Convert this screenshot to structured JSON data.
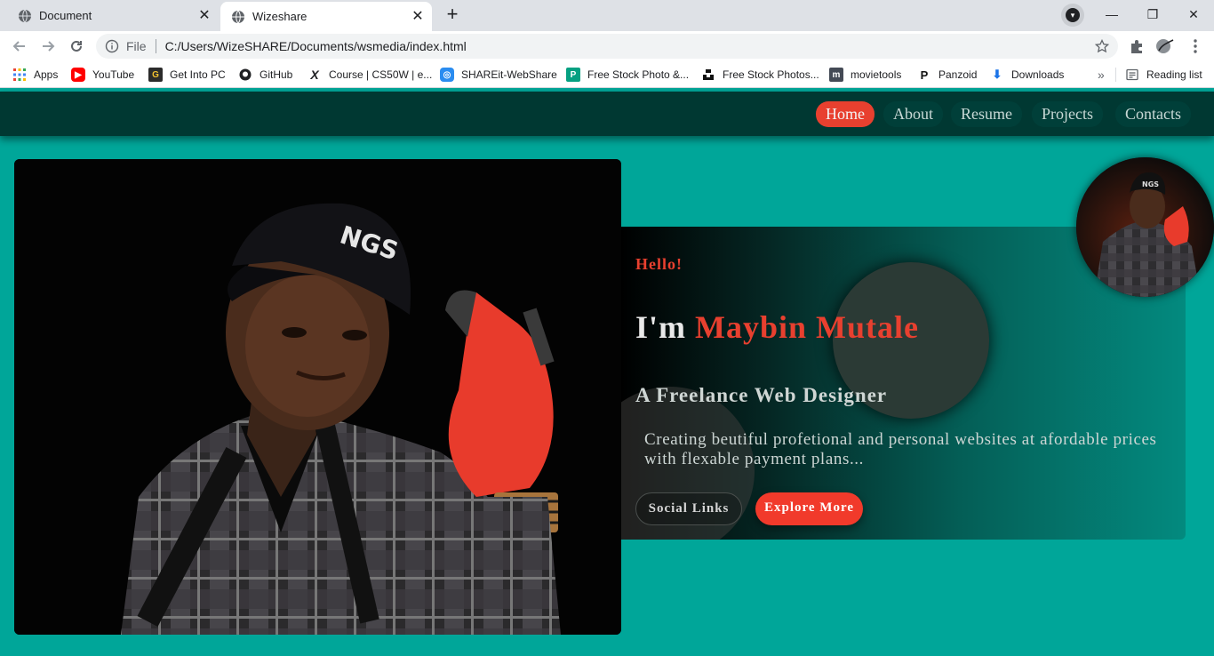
{
  "browser": {
    "tabs": [
      {
        "title": "Document",
        "active": false
      },
      {
        "title": "Wizeshare",
        "active": true
      }
    ],
    "address": {
      "scheme": "File",
      "url": "C:/Users/WizeSHARE/Documents/wsmedia/index.html"
    },
    "bookmarks": [
      {
        "label": "Apps",
        "icon": "apps-grid-icon"
      },
      {
        "label": "YouTube",
        "icon": "youtube-icon"
      },
      {
        "label": "Get Into PC",
        "icon": "getintopc-icon"
      },
      {
        "label": "GitHub",
        "icon": "github-icon"
      },
      {
        "label": "Course | CS50W | e...",
        "icon": "edx-icon"
      },
      {
        "label": "SHAREit-WebShare",
        "icon": "shareit-icon"
      },
      {
        "label": "Free Stock Photo &...",
        "icon": "pexels-icon"
      },
      {
        "label": "Free Stock Photos...",
        "icon": "unsplash-icon"
      },
      {
        "label": "movietools",
        "icon": "movietools-icon"
      },
      {
        "label": "Panzoid",
        "icon": "panzoid-icon"
      },
      {
        "label": "Downloads",
        "icon": "download-icon"
      }
    ],
    "overflow_label": "»",
    "reading_list": "Reading list"
  },
  "site": {
    "nav": [
      "Home",
      "About",
      "Resume",
      "Projects",
      "Contacts"
    ],
    "active_nav": "Home",
    "hero": {
      "greeting": "Hello!",
      "name_prefix": "I'm ",
      "name": "Maybin Mutale",
      "role": "A Freelance Web Designer",
      "description": "Creating beutiful profetional and personal websites at afordable prices with flexable payment plans...",
      "buttons": {
        "social": "Social Links",
        "explore": "Explore More"
      }
    }
  },
  "colors": {
    "page_bg": "#00a699",
    "nav_bg": "#003832",
    "accent": "#e8402f"
  }
}
